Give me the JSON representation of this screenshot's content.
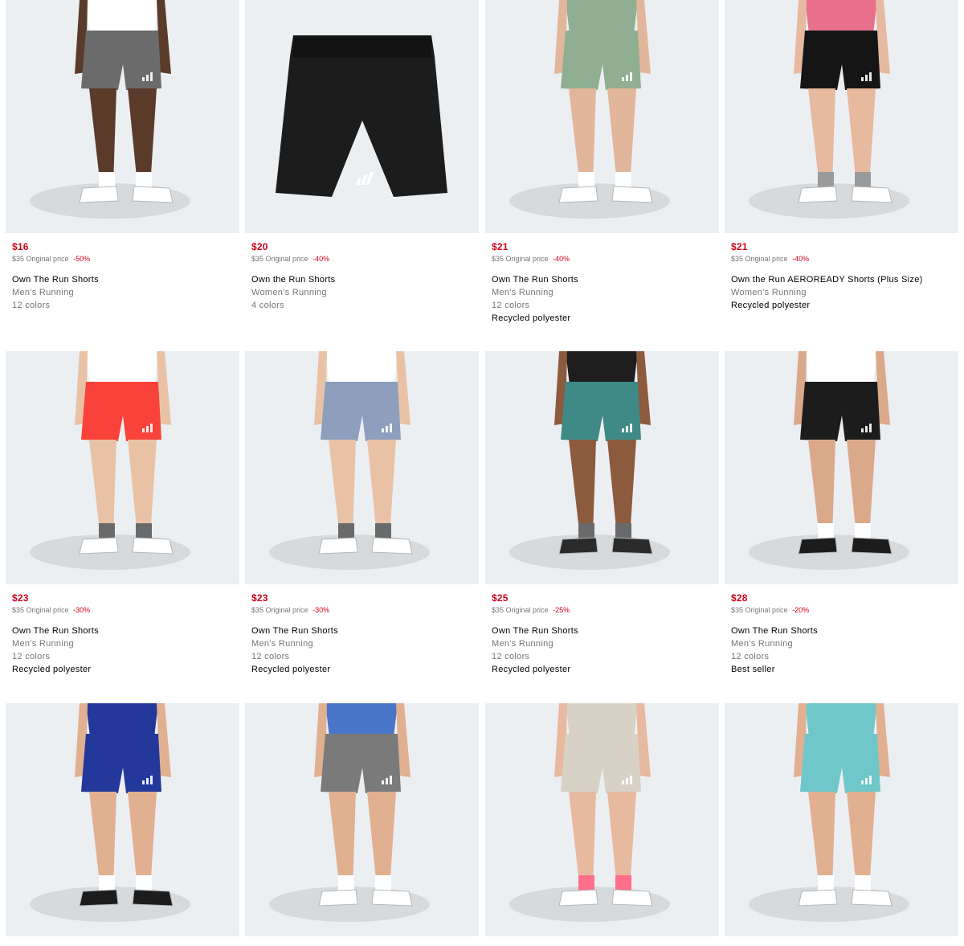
{
  "products": [
    {
      "price": "$16",
      "original_price": "$35",
      "original_label": "Original price",
      "discount": "-50%",
      "name": "Own The Run Shorts",
      "category": "Men's Running",
      "colors": "12 colors",
      "badge": "",
      "shorts_color": "#6b6b6b",
      "top_color": "#ffffff",
      "skin": "#5a3b2a",
      "shoe_color": "#ffffff",
      "sock_color": "#ffffff"
    },
    {
      "price": "$20",
      "original_price": "$35",
      "original_label": "Original price",
      "discount": "-40%",
      "name": "Own the Run Shorts",
      "category": "Women's Running",
      "colors": "4 colors",
      "badge": "",
      "shorts_color": "#1c1c1c",
      "top_color": "",
      "skin": "",
      "shoe_color": "",
      "sock_color": ""
    },
    {
      "price": "$21",
      "original_price": "$35",
      "original_label": "Original price",
      "discount": "-40%",
      "name": "Own The Run Shorts",
      "category": "Men's Running",
      "colors": "12 colors",
      "badge": "Recycled polyester",
      "shorts_color": "#8fae92",
      "top_color": "#8fae92",
      "skin": "#e2b69a",
      "shoe_color": "#ffffff",
      "sock_color": "#ffffff"
    },
    {
      "price": "$21",
      "original_price": "$35",
      "original_label": "Original price",
      "discount": "-40%",
      "name": "Own the Run AEROREADY Shorts (Plus Size)",
      "category": "Women's Running",
      "colors": "",
      "badge": "Recycled polyester",
      "shorts_color": "#151515",
      "top_color": "#e8708a",
      "skin": "#e7b99e",
      "shoe_color": "#ffffff",
      "sock_color": "#9a9a9a"
    },
    {
      "price": "$23",
      "original_price": "$35",
      "original_label": "Original price",
      "discount": "-30%",
      "name": "Own The Run Shorts",
      "category": "Men's Running",
      "colors": "12 colors",
      "badge": "Recycled polyester",
      "shorts_color": "#f9433a",
      "top_color": "#ffffff",
      "skin": "#e9c2a6",
      "shoe_color": "#ffffff",
      "sock_color": "#6a6a6a"
    },
    {
      "price": "$23",
      "original_price": "$35",
      "original_label": "Original price",
      "discount": "-30%",
      "name": "Own The Run Shorts",
      "category": "Men's Running",
      "colors": "12 colors",
      "badge": "Recycled polyester",
      "shorts_color": "#8e9fbe",
      "top_color": "#ffffff",
      "skin": "#e9c2a6",
      "shoe_color": "#ffffff",
      "sock_color": "#6a6a6a"
    },
    {
      "price": "$25",
      "original_price": "$35",
      "original_label": "Original price",
      "discount": "-25%",
      "name": "Own The Run Shorts",
      "category": "Men's Running",
      "colors": "12 colors",
      "badge": "Recycled polyester",
      "shorts_color": "#3f8a86",
      "top_color": "#1e1e1e",
      "skin": "#8c5a3c",
      "shoe_color": "#2a2a2a",
      "sock_color": "#6a6a6a"
    },
    {
      "price": "$28",
      "original_price": "$35",
      "original_label": "Original price",
      "discount": "-20%",
      "name": "Own The Run Shorts",
      "category": "Men's Running",
      "colors": "12 colors",
      "badge": "Best seller",
      "shorts_color": "#1c1c1c",
      "top_color": "#ffffff",
      "skin": "#d9a98a",
      "shoe_color": "#1c1c1c",
      "sock_color": "#ffffff"
    },
    {
      "price": "",
      "original_price": "",
      "original_label": "",
      "discount": "",
      "name": "",
      "category": "",
      "colors": "",
      "badge": "",
      "shorts_color": "#23389a",
      "top_color": "#23389a",
      "skin": "#e0b090",
      "shoe_color": "#1c1c1c",
      "sock_color": "#ffffff"
    },
    {
      "price": "",
      "original_price": "",
      "original_label": "",
      "discount": "",
      "name": "",
      "category": "",
      "colors": "",
      "badge": "",
      "shorts_color": "#7a7a7a",
      "top_color": "#4a76c9",
      "skin": "#e0b090",
      "shoe_color": "#ffffff",
      "sock_color": "#ffffff"
    },
    {
      "price": "",
      "original_price": "",
      "original_label": "",
      "discount": "",
      "name": "",
      "category": "",
      "colors": "",
      "badge": "",
      "shorts_color": "#d8d2c6",
      "top_color": "#d8d2c6",
      "skin": "#e7b99e",
      "shoe_color": "#ffffff",
      "sock_color": "#ff6f8a"
    },
    {
      "price": "",
      "original_price": "",
      "original_label": "",
      "discount": "",
      "name": "",
      "category": "",
      "colors": "",
      "badge": "",
      "shorts_color": "#6fc7c9",
      "top_color": "#6fc7c9",
      "skin": "#e0b090",
      "shoe_color": "#ffffff",
      "sock_color": "#ffffff"
    }
  ]
}
